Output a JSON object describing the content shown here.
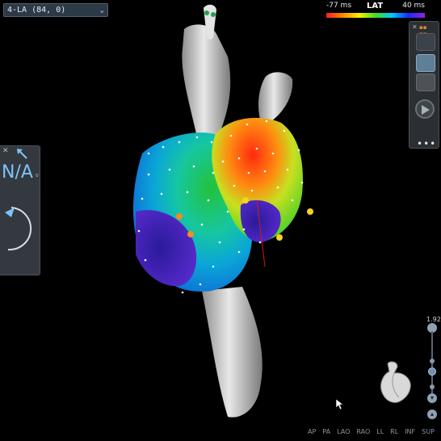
{
  "map_selector": {
    "value": "4-LA (84, 0)"
  },
  "lat_legend": {
    "title": "LAT",
    "min_label": "-77 ms",
    "max_label": "40 ms"
  },
  "left_widget": {
    "value": "N/A",
    "unit": "₀"
  },
  "zoom": {
    "value": "1.92"
  },
  "view_buttons": [
    "AP",
    "PA",
    "LAO",
    "RAO",
    "LL",
    "RL",
    "INF",
    "SUP"
  ],
  "icons": {
    "map_chevron": "chevron-down-icon",
    "toolbar_more": "more-horizontal-icon",
    "play": "play-icon",
    "orientation": "heart-orientation-icon",
    "cursor": "mouse-pointer-icon"
  },
  "colors": {
    "background": "#000000",
    "panel": "#33393f",
    "accent_blue": "#7ec3f6",
    "anatomy_shell": "#c8c8c8"
  }
}
